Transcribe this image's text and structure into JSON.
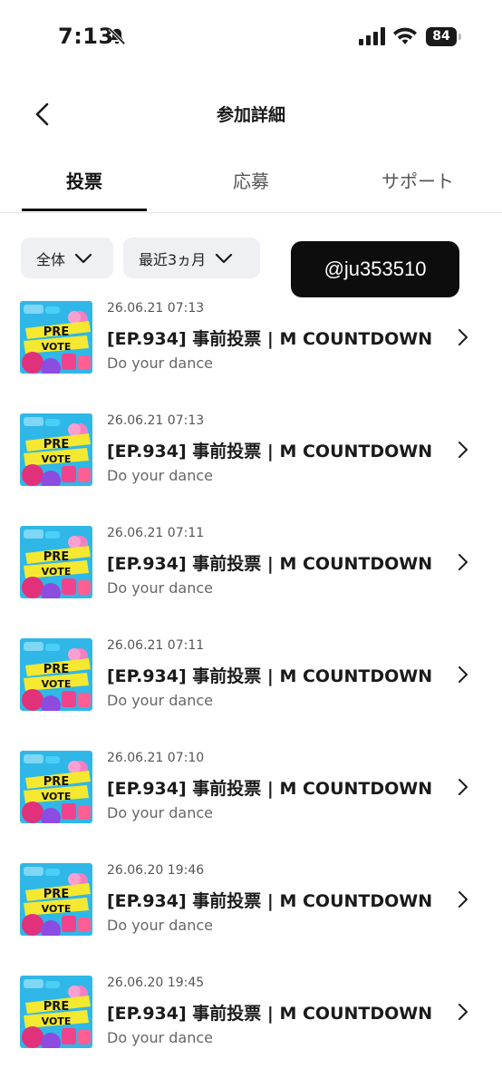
{
  "status": {
    "time": "7:13",
    "battery": "84",
    "icons": [
      "bell-slash-icon",
      "signal-icon",
      "wifi-icon",
      "battery-icon"
    ]
  },
  "nav": {
    "title": "参加詳細",
    "back_icon": "chevron-left-icon"
  },
  "tabs": [
    {
      "label": "投票",
      "active": true
    },
    {
      "label": "応募",
      "active": false
    },
    {
      "label": "サポート",
      "active": false
    }
  ],
  "filters": {
    "category": "全体",
    "period": "最近3ヵ月"
  },
  "watermark": "@ju353510",
  "colors": {
    "accent_dark": "#111111",
    "chip_bg": "#eef0f3",
    "thumb_bg": "#2fb7e8",
    "thumb_banner": "#f5e830"
  },
  "thumbnail_text": {
    "line1": "PRE",
    "line2": "VOTE"
  },
  "items": [
    {
      "time": "26.06.21 07:13",
      "title": "[EP.934] 事前投票 | M COUNTDOWN",
      "subtitle": "Do your dance"
    },
    {
      "time": "26.06.21 07:13",
      "title": "[EP.934] 事前投票 | M COUNTDOWN",
      "subtitle": "Do your dance"
    },
    {
      "time": "26.06.21 07:11",
      "title": "[EP.934] 事前投票 | M COUNTDOWN",
      "subtitle": "Do your dance"
    },
    {
      "time": "26.06.21 07:11",
      "title": "[EP.934] 事前投票 | M COUNTDOWN",
      "subtitle": "Do your dance"
    },
    {
      "time": "26.06.21 07:10",
      "title": "[EP.934] 事前投票 | M COUNTDOWN",
      "subtitle": "Do your dance"
    },
    {
      "time": "26.06.20 19:46",
      "title": "[EP.934] 事前投票 | M COUNTDOWN",
      "subtitle": "Do your dance"
    },
    {
      "time": "26.06.20 19:45",
      "title": "[EP.934] 事前投票 | M COUNTDOWN",
      "subtitle": "Do your dance"
    }
  ]
}
